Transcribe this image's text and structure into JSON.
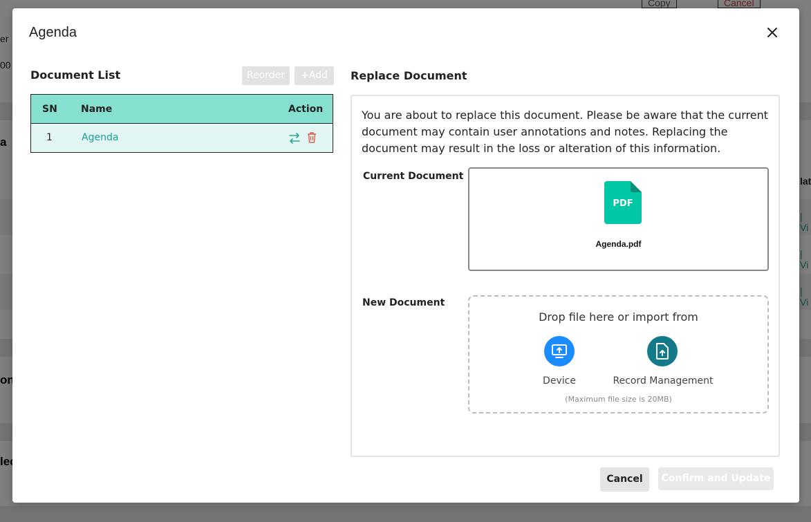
{
  "background": {
    "top_buttons": [
      "Copy",
      "Cancel"
    ],
    "left_fragments": [
      "er",
      "00",
      "a",
      "on",
      "lec"
    ],
    "right_fragments": [
      "late",
      "| Vi",
      "| Vi",
      "| Vi"
    ]
  },
  "modal": {
    "title": "Agenda",
    "close_icon": "close-icon"
  },
  "document_list": {
    "title": "Document List",
    "reorder_label": "Reorder",
    "add_label": "Add",
    "columns": [
      "SN",
      "Name",
      "Action"
    ],
    "rows": [
      {
        "sn": "1",
        "name": "Agenda",
        "actions": [
          "replace-icon",
          "trash-icon"
        ]
      }
    ]
  },
  "replace": {
    "title": "Replace Document",
    "warning": "You are about to replace this document. Please be aware that the current document may contain user annotations and notes. Replacing the document may result in the loss or alteration of this information.",
    "current_label": "Current Document",
    "current_file": {
      "type_badge": "PDF",
      "name": "Agenda.pdf"
    },
    "new_label": "New Document",
    "drop_text": "Drop file here or import from",
    "sources": [
      {
        "label": "Device",
        "icon": "monitor-upload-icon",
        "color": "#1a8cff"
      },
      {
        "label": "Record Management",
        "icon": "file-upload-icon",
        "color": "#137a8a"
      }
    ],
    "max_size": "(Maximum file size is 20MB)"
  },
  "footer": {
    "cancel_label": "Cancel",
    "confirm_label": "Confirm and Update"
  },
  "colors": {
    "table_header": "#86e0cf",
    "table_row": "#e2f7f3",
    "link": "#1a9e95",
    "pdf": "#00c8a6",
    "trash": "#e05a4f"
  }
}
